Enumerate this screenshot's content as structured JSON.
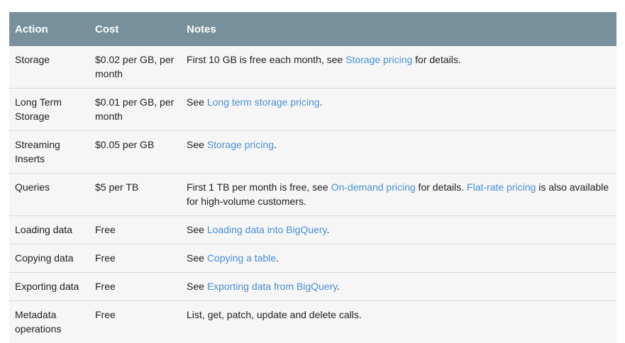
{
  "table": {
    "headers": {
      "action": "Action",
      "cost": "Cost",
      "notes": "Notes"
    },
    "rows": [
      {
        "action": "Storage",
        "cost": "$0.02 per GB, per month",
        "notes_before": "First 10 GB is free each month, see ",
        "link1": "Storage pricing",
        "notes_middle": " for details.",
        "link2": "",
        "notes_after": ""
      },
      {
        "action": "Long Term Storage",
        "cost": "$0.01 per GB, per month",
        "notes_before": "See ",
        "link1": "Long term storage pricing",
        "notes_middle": ".",
        "link2": "",
        "notes_after": ""
      },
      {
        "action": "Streaming Inserts",
        "cost": "$0.05 per GB",
        "notes_before": "See ",
        "link1": "Storage pricing",
        "notes_middle": ".",
        "link2": "",
        "notes_after": ""
      },
      {
        "action": "Queries",
        "cost": "$5 per TB",
        "notes_before": "First 1 TB per month is free, see ",
        "link1": "On-demand pricing",
        "notes_middle": " for details. ",
        "link2": "Flat-rate pricing",
        "notes_after": " is also available for high-volume customers."
      },
      {
        "action": "Loading data",
        "cost": "Free",
        "notes_before": "See ",
        "link1": "Loading data into BigQuery",
        "notes_middle": ".",
        "link2": "",
        "notes_after": ""
      },
      {
        "action": "Copying data",
        "cost": "Free",
        "notes_before": "See ",
        "link1": "Copying a table",
        "notes_middle": ".",
        "link2": "",
        "notes_after": ""
      },
      {
        "action": "Exporting data",
        "cost": "Free",
        "notes_before": "See ",
        "link1": "Exporting data from BigQuery",
        "notes_middle": ".",
        "link2": "",
        "notes_after": ""
      },
      {
        "action": "Metadata operations",
        "cost": "Free",
        "notes_before": "List, get, patch, update and delete calls.",
        "link1": "",
        "notes_middle": "",
        "link2": "",
        "notes_after": ""
      }
    ]
  },
  "colors": {
    "header_bg": "#78909c",
    "link": "#4a8fd4",
    "row_bg": "#f6f6f6"
  }
}
